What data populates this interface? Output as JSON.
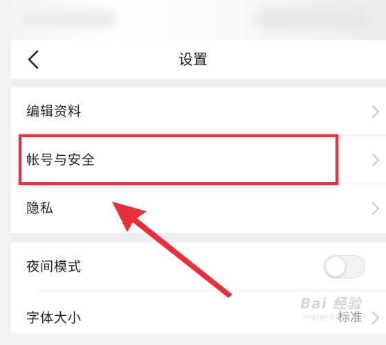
{
  "header": {
    "title": "设置",
    "back_icon": "chevron-left-icon"
  },
  "menu": {
    "edit_profile": "编辑资料",
    "account_security": "帐号与安全",
    "privacy": "隐私",
    "night_mode": "夜间模式",
    "night_mode_enabled": false,
    "font_size": "字体大小",
    "font_size_value": "标准"
  },
  "annotation": {
    "highlight_color": "#e8303a"
  },
  "watermark": {
    "brand": "Bai 经验",
    "url": "jingyan.baidu.com"
  }
}
